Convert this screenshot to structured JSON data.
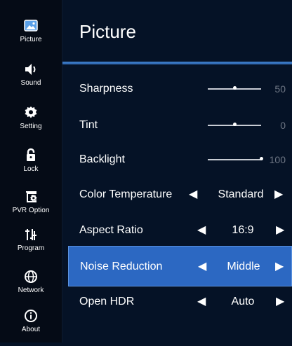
{
  "sidebar": {
    "items": [
      {
        "label": "Picture",
        "icon": "picture-icon"
      },
      {
        "label": "Sound",
        "icon": "speaker-icon"
      },
      {
        "label": "Setting",
        "icon": "gear-icon"
      },
      {
        "label": "Lock",
        "icon": "lock-icon"
      },
      {
        "label": "PVR Option",
        "icon": "pvr-gear-icon"
      },
      {
        "label": "Program",
        "icon": "antenna-icon"
      },
      {
        "label": "Network",
        "icon": "globe-icon"
      },
      {
        "label": "About",
        "icon": "info-icon"
      }
    ]
  },
  "main": {
    "title": "Picture",
    "rows": [
      {
        "label": "Sharpness",
        "type": "slider",
        "value": "50",
        "fill": 0.5
      },
      {
        "label": "Tint",
        "type": "slider",
        "value": "0",
        "fill": 0.5
      },
      {
        "label": "Backlight",
        "type": "slider",
        "value": "100",
        "fill": 1.0
      },
      {
        "label": "Color Temperature",
        "type": "option",
        "value": "Standard",
        "left_arrow": "◀",
        "right_arrow": "▶"
      },
      {
        "label": "Aspect Ratio",
        "type": "option",
        "value": "16:9",
        "left_arrow": "◀",
        "right_arrow": "▶"
      },
      {
        "label": "Noise Reduction",
        "type": "option",
        "value": "Middle",
        "left_arrow": "◀",
        "right_arrow": "▶",
        "selected": true
      },
      {
        "label": "Open HDR",
        "type": "option",
        "value": "Auto",
        "left_arrow": "◀",
        "right_arrow": "▶"
      }
    ]
  },
  "colors": {
    "background": "#051226",
    "sidebar": "#050b16",
    "selected_row": "#2c68c2",
    "accent_rule": "#3d7fce"
  }
}
